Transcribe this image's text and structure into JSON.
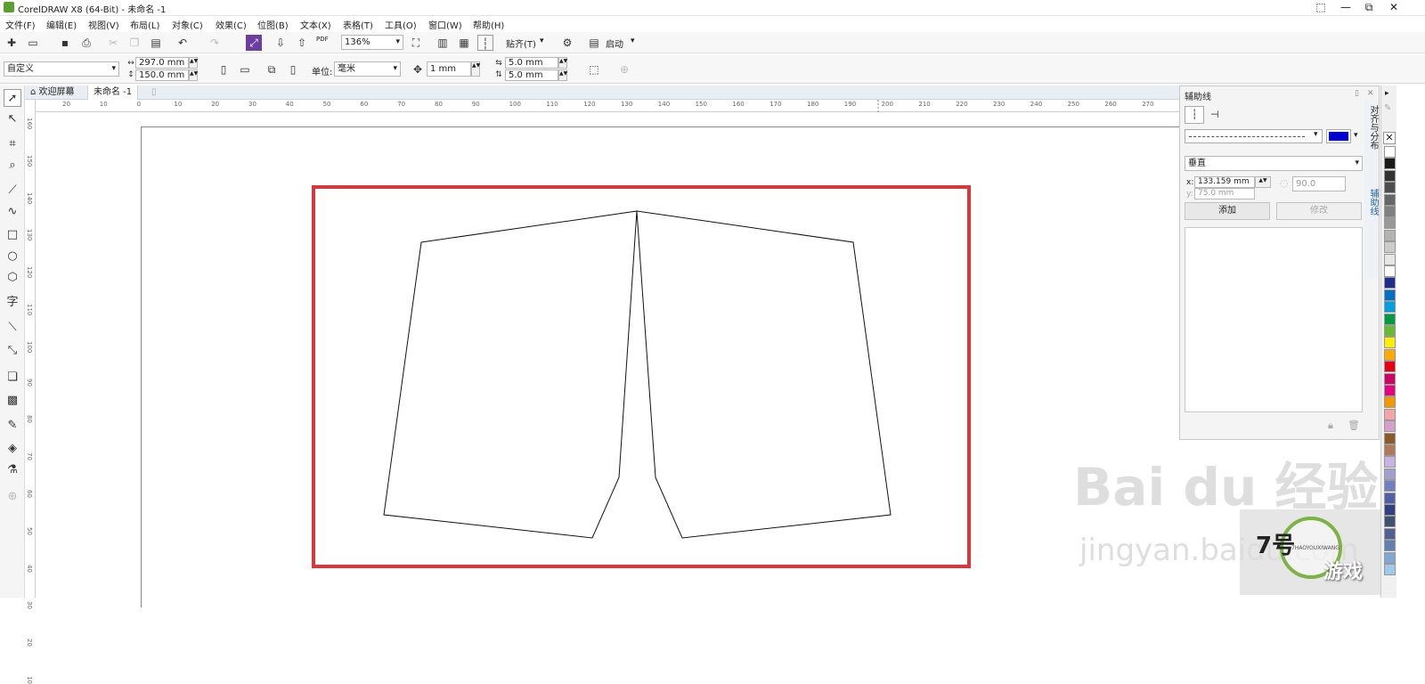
{
  "window": {
    "title": "CorelDRAW X8 (64-Bit) - 未命名 -1",
    "controls": [
      "⬚",
      "—",
      "⧉",
      "✕"
    ]
  },
  "menu": [
    "文件(F)",
    "编辑(E)",
    "视图(V)",
    "布局(L)",
    "对象(C)",
    "效果(C)",
    "位图(B)",
    "文本(X)",
    "表格(T)",
    "工具(O)",
    "窗口(W)",
    "帮助(H)"
  ],
  "toolbar1": {
    "pdf_label": "PDF",
    "zoom": "136%",
    "snap_label": "贴齐(T)",
    "launch_label": "启动"
  },
  "toolbar2": {
    "page_preset": "自定义",
    "width": "297.0 mm",
    "height": "150.0 mm",
    "units_label": "单位:",
    "units_value": "毫米",
    "nudge": "1 mm",
    "dup_x": "5.0 mm",
    "dup_y": "5.0 mm"
  },
  "tabs": {
    "welcome": "欢迎屏幕",
    "document": "未命名 -1"
  },
  "ruler": {
    "h_ticks": [
      "20",
      "10",
      "0",
      "10",
      "20",
      "30",
      "40",
      "50",
      "60",
      "70",
      "80",
      "90",
      "100",
      "110",
      "120",
      "130",
      "140",
      "150",
      "160",
      "170",
      "180",
      "190",
      "200",
      "210",
      "220",
      "230",
      "240",
      "250",
      "260",
      "270"
    ],
    "v_ticks": [
      "160",
      "150",
      "140",
      "130",
      "120",
      "110",
      "100",
      "90",
      "80",
      "70",
      "60",
      "50",
      "40",
      "30",
      "20",
      "10"
    ]
  },
  "docker": {
    "title": "辅助线",
    "guide_type": "垂直",
    "x_value": "133.159 mm",
    "y_value": "75.0 mm",
    "angle_value": "90.0",
    "add_button": "添加",
    "modify_button": "修改",
    "line_color": "#0000cc"
  },
  "side_tabs": [
    "对齐与分布",
    "辅助线"
  ],
  "palette": [
    "#ffffff",
    "#1a1a1a",
    "#333333",
    "#4d4d4d",
    "#666666",
    "#808080",
    "#999999",
    "#b3b3b3",
    "#cccccc",
    "#e6e6e6",
    "#ffffff",
    "#1f2e8c",
    "#0070c0",
    "#00a0e0",
    "#009944",
    "#66bb33",
    "#ffee00",
    "#ffaa00",
    "#e60012",
    "#cc0066",
    "#e4007f",
    "#f39800",
    "#f5a5a5",
    "#d4a0c8",
    "#8b5a2b",
    "#b07a5a",
    "#c8b4e0",
    "#a0a0d0",
    "#7080c0",
    "#5060a8",
    "#304080",
    "#405070",
    "#506090",
    "#6080b0",
    "#80a8d0",
    "#a0c8e8"
  ],
  "watermark": {
    "brand": "Bai du 经验",
    "url": "jingyan.baidu.com",
    "logo_num": "7号",
    "logo_text": "游戏",
    "logo_sub": "7HAOYOUXIWANG"
  },
  "colors": {
    "highlight": "#d9383a",
    "accent": "#5a9e2e"
  }
}
